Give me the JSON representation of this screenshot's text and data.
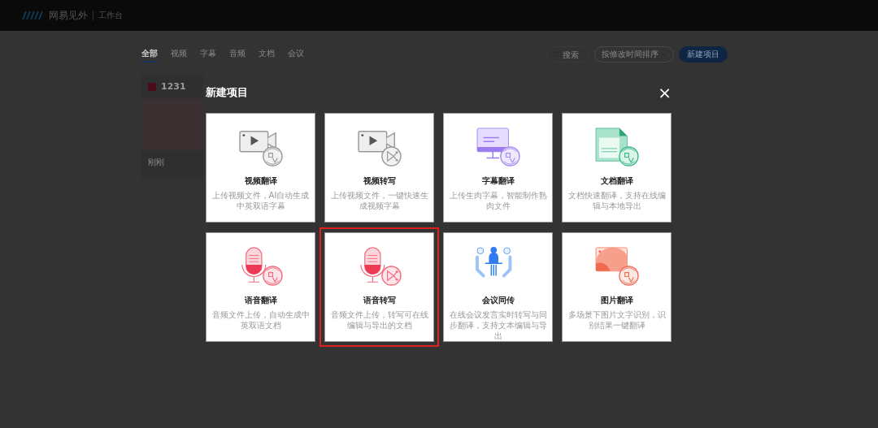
{
  "header": {
    "brand": "网易见外",
    "section": "工作台"
  },
  "tabs": [
    {
      "label": "全部",
      "selected": true
    },
    {
      "label": "视频",
      "selected": false
    },
    {
      "label": "字幕",
      "selected": false
    },
    {
      "label": "音频",
      "selected": false
    },
    {
      "label": "文档",
      "selected": false
    },
    {
      "label": "会议",
      "selected": false
    }
  ],
  "toolbar": {
    "search": {
      "placeholder": "搜索"
    },
    "sort": "按修改时间排序",
    "new_button": "新建项目"
  },
  "projects": [
    {
      "title": "1231",
      "time": "刚刚"
    }
  ],
  "dialog": {
    "title": "新建项目",
    "close": "×",
    "cards": [
      {
        "kind": "video-translate",
        "title": "视频翻译",
        "description": "上传视频文件，AI自动生成中英双语字幕",
        "selected": false
      },
      {
        "kind": "video-transcribe",
        "title": "视频转写",
        "description": "上传视频文件，一键快速生成视频字幕",
        "selected": false
      },
      {
        "kind": "subtitle-translate",
        "title": "字幕翻译",
        "description": "上传生肉字幕，智能制作熟肉文件",
        "selected": false
      },
      {
        "kind": "document-translate",
        "title": "文档翻译",
        "description": "文档快速翻译，支持在线编辑与本地导出",
        "selected": false
      },
      {
        "kind": "audio-translate",
        "title": "语音翻译",
        "description": "音频文件上传，自动生成中英双语文档",
        "selected": false
      },
      {
        "kind": "audio-transcribe",
        "title": "语音转写",
        "description": "音频文件上传，转写可在线编辑与导出的文档",
        "selected": true
      },
      {
        "kind": "meeting",
        "title": "会议同传",
        "description": "在线会议发言实时转写与同步翻译，支持文本编辑与导出",
        "selected": false
      },
      {
        "kind": "image-translate",
        "title": "图片翻译",
        "description": "多场景下图片文字识别，识别结果一键翻译",
        "selected": false
      }
    ]
  }
}
